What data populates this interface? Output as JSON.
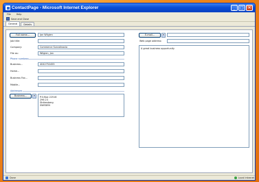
{
  "window": {
    "title": "ContactPage - Microsoft Internet Explorer",
    "minimize": "_",
    "maximize": "□",
    "close": "✕"
  },
  "menu": {
    "items": [
      "File",
      "Help"
    ]
  },
  "toolbar": {
    "save_close_label": "Save and Close"
  },
  "tabs": [
    "General",
    "Details"
  ],
  "left": {
    "full_name_button": "Full name...",
    "full_name_value": "Jan Wilgien",
    "job_title_label": "Job title:",
    "job_title_value": "",
    "company_label": "Company:",
    "company_value": "Commerce Scandinavia",
    "file_as_label": "File as:",
    "file_as_value": "Wilgien, Jan",
    "phone_section": "Phone numbers",
    "business_label": "Business...",
    "business_value": "4042752455",
    "home_label": "Home...",
    "business_fax_label": "Business Fax...",
    "mobile_label": "Mobile...",
    "addresses_section": "Addresses",
    "address_button": "Business...",
    "address_value": "P.O.Box 22516\n296 23\nStrömsberg\nSWEDEN"
  },
  "right": {
    "email_button": "E-mail...",
    "email_value": "",
    "webpage_label": "Web page address:",
    "webpage_value": "",
    "notes_value": "A great business opportunity"
  },
  "status": {
    "left": "Done",
    "right": "Local intranet"
  }
}
